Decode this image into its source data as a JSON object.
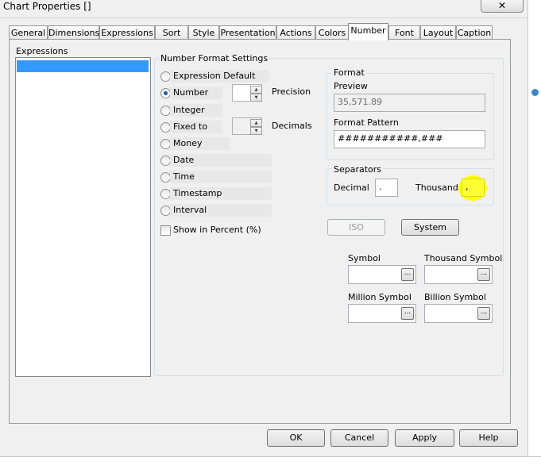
{
  "window": {
    "title": "Chart Properties []",
    "close_glyph": "✕"
  },
  "tabs": [
    {
      "label": "General",
      "active": false
    },
    {
      "label": "Dimensions",
      "active": false
    },
    {
      "label": "Expressions",
      "active": false
    },
    {
      "label": "Sort",
      "active": false
    },
    {
      "label": "Style",
      "active": false
    },
    {
      "label": "Presentation",
      "active": false
    },
    {
      "label": "Actions",
      "active": false
    },
    {
      "label": "Colors",
      "active": false
    },
    {
      "label": "Number",
      "active": true
    },
    {
      "label": "Font",
      "active": false
    },
    {
      "label": "Layout",
      "active": false
    },
    {
      "label": "Caption",
      "active": false
    }
  ],
  "expressions": {
    "label": "Expressions",
    "items": [
      ""
    ]
  },
  "number_format": {
    "title": "Number Format Settings",
    "options": [
      {
        "label": "Expression Default",
        "selected": false
      },
      {
        "label": "Number",
        "selected": true
      },
      {
        "label": "Integer",
        "selected": false
      },
      {
        "label": "Fixed to",
        "selected": false
      },
      {
        "label": "Money",
        "selected": false
      },
      {
        "label": "Date",
        "selected": false
      },
      {
        "label": "Time",
        "selected": false
      },
      {
        "label": "Timestamp",
        "selected": false
      },
      {
        "label": "Interval",
        "selected": false
      }
    ],
    "precision_label": "Precision",
    "decimals_label": "Decimals",
    "precision_value": "",
    "decimals_value": "",
    "show_percent_label": "Show in Percent (%)",
    "show_percent_checked": false
  },
  "format": {
    "title": "Format",
    "preview_label": "Preview",
    "preview_value": "35,571.89",
    "pattern_label": "Format Pattern",
    "pattern_value": "###########,###"
  },
  "separators": {
    "title": "Separators",
    "decimal_label": "Decimal",
    "decimal_value": ".",
    "thousand_label": "Thousand",
    "thousand_value": ",",
    "highlight_color": "#ffff00"
  },
  "buttons": {
    "iso": "ISO",
    "system": "System"
  },
  "symbols": {
    "symbol_label": "Symbol",
    "thousand_symbol_label": "Thousand Symbol",
    "million_symbol_label": "Million Symbol",
    "billion_symbol_label": "Billion Symbol",
    "browse_glyph": "..."
  },
  "footer": {
    "ok": "OK",
    "cancel": "Cancel",
    "apply": "Apply",
    "help": "Help"
  }
}
